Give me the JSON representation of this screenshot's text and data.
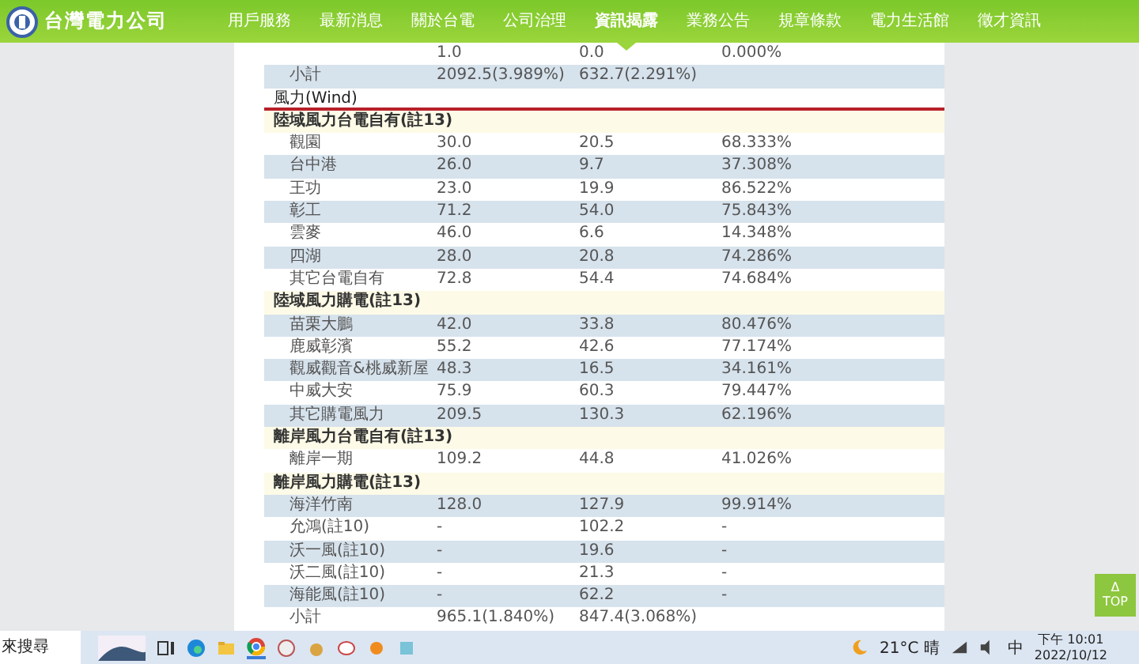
{
  "header": {
    "logo_text": "台灣電力公司",
    "nav": [
      {
        "label": "用戶服務",
        "selected": false
      },
      {
        "label": "最新消息",
        "selected": false
      },
      {
        "label": "關於台電",
        "selected": false
      },
      {
        "label": "公司治理",
        "selected": false
      },
      {
        "label": "資訊揭露",
        "selected": true
      },
      {
        "label": "業務公告",
        "selected": false
      },
      {
        "label": "規章條款",
        "selected": false
      },
      {
        "label": "電力生活館",
        "selected": false
      },
      {
        "label": "徵才資訊",
        "selected": false
      }
    ]
  },
  "table": {
    "rows": [
      {
        "kind": "item",
        "cells": [
          "1.0",
          "0.0",
          "0.000%"
        ],
        "shaded": false
      },
      {
        "kind": "item",
        "name": "小計",
        "cells": [
          "2092.5(3.989%)",
          "632.7(2.291%)"
        ],
        "shaded": true
      },
      {
        "kind": "section",
        "name": "風力(Wind)"
      },
      {
        "kind": "group",
        "name": "陸域風力台電自有(註13)"
      },
      {
        "kind": "item",
        "name": "觀園",
        "cells": [
          "30.0",
          "20.5",
          "68.333%"
        ],
        "shaded": false
      },
      {
        "kind": "item",
        "name": "台中港",
        "cells": [
          "26.0",
          "9.7",
          "37.308%"
        ],
        "shaded": true
      },
      {
        "kind": "item",
        "name": "王功",
        "cells": [
          "23.0",
          "19.9",
          "86.522%"
        ],
        "shaded": false
      },
      {
        "kind": "item",
        "name": "彰工",
        "cells": [
          "71.2",
          "54.0",
          "75.843%"
        ],
        "shaded": true
      },
      {
        "kind": "item",
        "name": "雲麥",
        "cells": [
          "46.0",
          "6.6",
          "14.348%"
        ],
        "shaded": false
      },
      {
        "kind": "item",
        "name": "四湖",
        "cells": [
          "28.0",
          "20.8",
          "74.286%"
        ],
        "shaded": true
      },
      {
        "kind": "item",
        "name": "其它台電自有",
        "cells": [
          "72.8",
          "54.4",
          "74.684%"
        ],
        "shaded": false
      },
      {
        "kind": "group",
        "name": "陸域風力購電(註13)"
      },
      {
        "kind": "item",
        "name": "苗栗大鵬",
        "cells": [
          "42.0",
          "33.8",
          "80.476%"
        ],
        "shaded": true
      },
      {
        "kind": "item",
        "name": "鹿威彰濱",
        "cells": [
          "55.2",
          "42.6",
          "77.174%"
        ],
        "shaded": false
      },
      {
        "kind": "item",
        "name": "觀威觀音&桃威新屋",
        "cells": [
          "48.3",
          "16.5",
          "34.161%"
        ],
        "shaded": true
      },
      {
        "kind": "item",
        "name": "中威大安",
        "cells": [
          "75.9",
          "60.3",
          "79.447%"
        ],
        "shaded": false
      },
      {
        "kind": "item",
        "name": "其它購電風力",
        "cells": [
          "209.5",
          "130.3",
          "62.196%"
        ],
        "shaded": true
      },
      {
        "kind": "group",
        "name": "離岸風力台電自有(註13)"
      },
      {
        "kind": "item",
        "name": "離岸一期",
        "cells": [
          "109.2",
          "44.8",
          "41.026%"
        ],
        "shaded": false
      },
      {
        "kind": "group",
        "name": "離岸風力購電(註13)"
      },
      {
        "kind": "item",
        "name": "海洋竹南",
        "cells": [
          "128.0",
          "127.9",
          "99.914%"
        ],
        "shaded": true
      },
      {
        "kind": "item",
        "name": "允鴻(註10)",
        "cells": [
          "-",
          "102.2",
          "-"
        ],
        "shaded": false
      },
      {
        "kind": "item",
        "name": "沃一風(註10)",
        "cells": [
          "-",
          "19.6",
          "-"
        ],
        "shaded": true
      },
      {
        "kind": "item",
        "name": "沃二風(註10)",
        "cells": [
          "-",
          "21.3",
          "-"
        ],
        "shaded": false
      },
      {
        "kind": "item",
        "name": "海能風(註10)",
        "cells": [
          "-",
          "62.2",
          "-"
        ],
        "shaded": true
      },
      {
        "kind": "item",
        "name": "小計",
        "cells": [
          "965.1(1.840%)",
          "847.4(3.068%)"
        ],
        "shaded": false
      }
    ]
  },
  "top_button": {
    "arrow": "Δ",
    "label": "TOP"
  },
  "taskbar": {
    "search_text": "來搜尋",
    "weather": "21°C 晴",
    "ime": "中",
    "time": "下午 10:01",
    "date": "2022/10/12"
  }
}
